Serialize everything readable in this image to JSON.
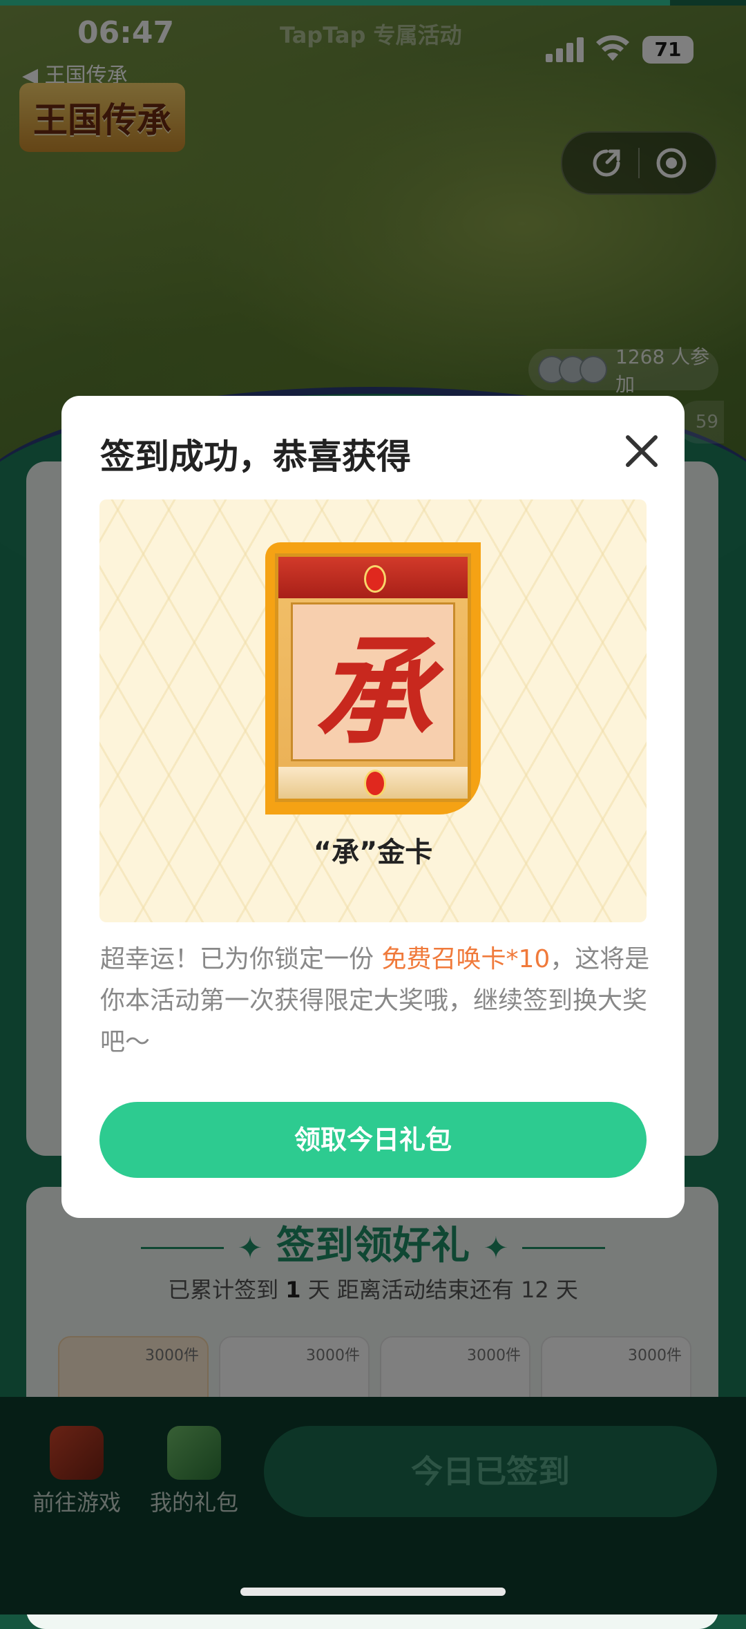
{
  "status_bar": {
    "time": "06:47",
    "center_label": "TapTap 专属活动",
    "battery": "71",
    "back_label": "王国传承"
  },
  "hero": {
    "game_logo_text": "王国传承",
    "participants": "1268 人参加",
    "partial_pill": "59"
  },
  "checkin_section": {
    "title": "签到领好礼",
    "summary_prefix": "已累计签到 ",
    "summary_days": "1",
    "summary_suffix": " 天   距离活动结束还有 12 天",
    "day_cards": [
      "3000件",
      "3000件",
      "3000件",
      "3000件"
    ]
  },
  "bottom_bar": {
    "go_game_label": "前往游戏",
    "my_gifts_label": "我的礼包",
    "checked_in_button": "今日已签到"
  },
  "dialog": {
    "title": "签到成功，恭喜获得",
    "reward_name": "“承”金卡",
    "card_glyph": "承",
    "desc_before": "超幸运！已为你锁定一份 ",
    "desc_highlight": "免费召唤卡*10",
    "desc_after": "，这将是你本活动第一次获得限定大奖哦，继续签到换大奖吧～",
    "button_label": "领取今日礼包"
  },
  "colors": {
    "accent_green": "#2dcb90",
    "highlight_orange": "#f07a3b",
    "bottom_bar_bg": "#0d3d2c"
  },
  "icons": [
    "signal-icon",
    "wifi-icon",
    "battery-icon",
    "back-arrow-icon",
    "share-icon",
    "record-icon",
    "close-icon"
  ]
}
